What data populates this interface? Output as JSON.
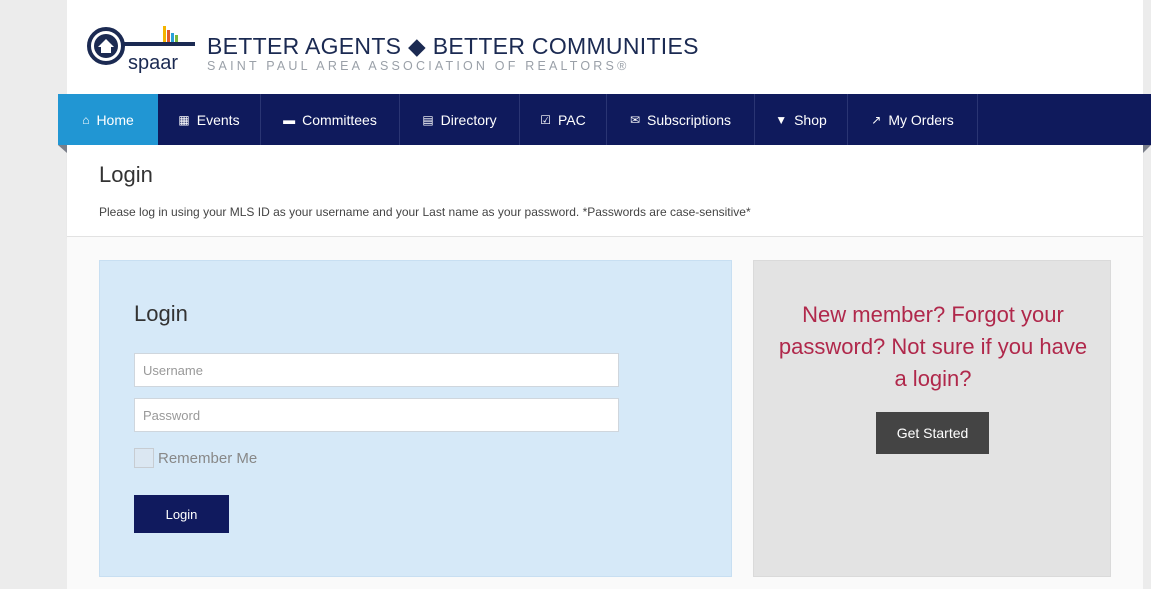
{
  "header": {
    "logo_text": "spaar",
    "tagline_main": "BETTER AGENTS ◆ BETTER COMMUNITIES",
    "tagline_sub": "SAINT PAUL AREA ASSOCIATION OF REALTORS®"
  },
  "nav": {
    "items": [
      {
        "label": "Home",
        "icon": "home-icon",
        "glyph": "⌂",
        "active": true
      },
      {
        "label": "Events",
        "icon": "calendar-icon",
        "glyph": "▦"
      },
      {
        "label": "Committees",
        "icon": "comment-icon",
        "glyph": "▬"
      },
      {
        "label": "Directory",
        "icon": "list-icon",
        "glyph": "▤"
      },
      {
        "label": "PAC",
        "icon": "check-square-icon",
        "glyph": "☑"
      },
      {
        "label": "Subscriptions",
        "icon": "envelope-icon",
        "glyph": "✉"
      },
      {
        "label": "Shop",
        "icon": "cart-icon",
        "glyph": "▼"
      },
      {
        "label": "My Orders",
        "icon": "pushpin-icon",
        "glyph": "↗"
      }
    ],
    "colors": {
      "bar": "#0f1a5c",
      "active": "#2196d3"
    }
  },
  "page": {
    "title": "Login",
    "description": "Please log in using your MLS ID as your username and your Last name as your password. *Passwords are case-sensitive*"
  },
  "login_form": {
    "title": "Login",
    "username_placeholder": "Username",
    "password_placeholder": "Password",
    "remember_label": "Remember Me",
    "submit_label": "Login"
  },
  "side_panel": {
    "text": "New member? Forgot your password? Not sure if you have a login?",
    "button_label": "Get Started",
    "text_color": "#b0284b"
  }
}
